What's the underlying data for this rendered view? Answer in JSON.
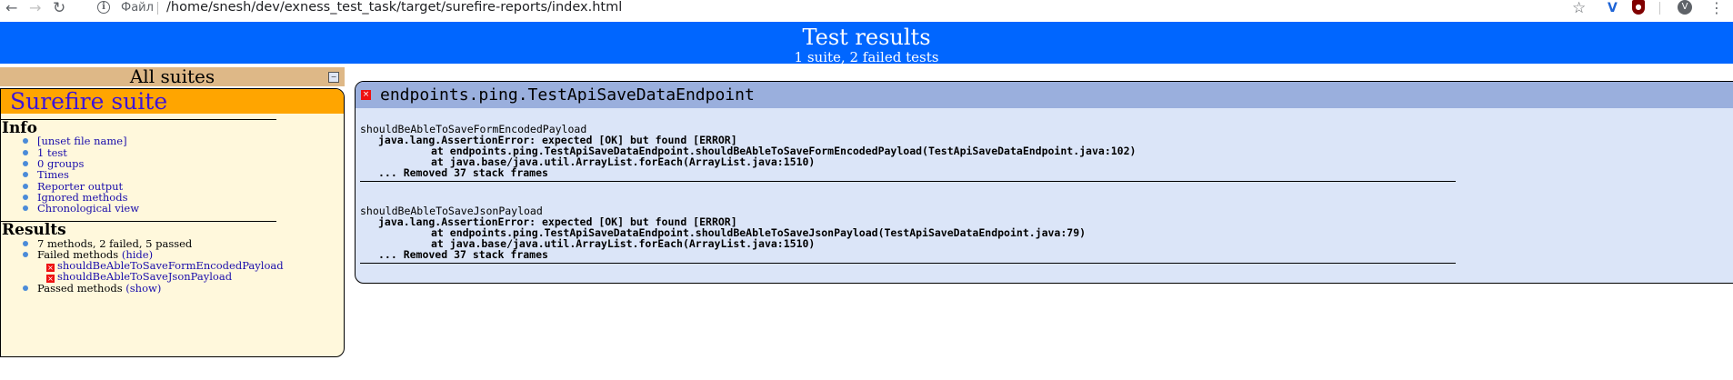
{
  "browser": {
    "file_label": "Файл",
    "url": "/home/snesh/dev/exness_test_task/target/surefire-reports/index.html",
    "avatar_letter": "V",
    "extension_letter": "V"
  },
  "header": {
    "title": "Test results",
    "subtitle": "1 suite, 2 failed tests"
  },
  "sidebar": {
    "all_suites": "All suites",
    "suite_name": "Surefire suite",
    "info_title": "Info",
    "info_items": [
      "[unset file name]",
      "1 test",
      "0 groups",
      "Times",
      "Reporter output",
      "Ignored methods",
      "Chronological view"
    ],
    "results_title": "Results",
    "results_summary": "7 methods, 2 failed, 5 passed",
    "failed_methods_label": "Failed methods",
    "failed_toggle": "(hide)",
    "failed_methods": [
      "shouldBeAbleToSaveFormEncodedPayload",
      "shouldBeAbleToSaveJsonPayload"
    ],
    "passed_methods_label": "Passed methods",
    "passed_toggle": "(show)"
  },
  "main": {
    "class_name": "endpoints.ping.TestApiSaveDataEndpoint",
    "tests": [
      {
        "name": "shouldBeAbleToSaveFormEncodedPayload",
        "error": "java.lang.AssertionError: expected [OK] but found [ERROR]",
        "frame1": "at endpoints.ping.TestApiSaveDataEndpoint.shouldBeAbleToSaveFormEncodedPayload(TestApiSaveDataEndpoint.java:102)",
        "frame2": "at java.base/java.util.ArrayList.forEach(ArrayList.java:1510)",
        "removed": "... Removed 37 stack frames"
      },
      {
        "name": "shouldBeAbleToSaveJsonPayload",
        "error": "java.lang.AssertionError: expected [OK] but found [ERROR]",
        "frame1": "at endpoints.ping.TestApiSaveDataEndpoint.shouldBeAbleToSaveJsonPayload(TestApiSaveDataEndpoint.java:79)",
        "frame2": "at java.base/java.util.ArrayList.forEach(ArrayList.java:1510)",
        "removed": "... Removed 37 stack frames"
      }
    ]
  }
}
